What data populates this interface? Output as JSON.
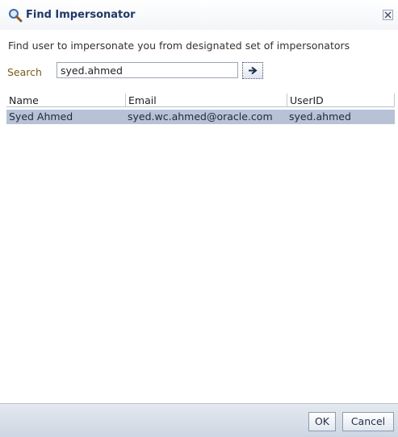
{
  "dialog": {
    "title": "Find Impersonator",
    "description": "Find user to impersonate you from designated set of impersonators"
  },
  "search": {
    "label": "Search",
    "value": "syed.ahmed"
  },
  "table": {
    "columns": [
      "Name",
      "Email",
      "UserID"
    ],
    "rows": [
      {
        "name": "Syed Ahmed",
        "email": "syed.wc.ahmed@oracle.com",
        "userid": "syed.ahmed",
        "selected": true
      }
    ]
  },
  "footer": {
    "ok_label": "OK",
    "cancel_label": "Cancel"
  },
  "colors": {
    "title": "#1f3a66",
    "search_label": "#7a5a1a",
    "selected_row": "#b7c2d6"
  },
  "icons": {
    "title": "magnifier-icon",
    "close": "close-icon",
    "go": "arrow-right-icon"
  }
}
